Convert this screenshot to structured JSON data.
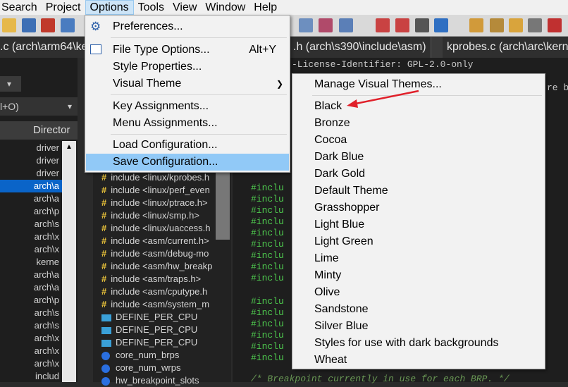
{
  "menubar": {
    "items": [
      "Search",
      "Project",
      "Options",
      "Tools",
      "View",
      "Window",
      "Help"
    ],
    "active": "Options"
  },
  "tabs": [
    {
      "label": ".c (arch\\arm64\\ke"
    },
    {
      "label": ".h (arch\\s390\\include\\asm)"
    },
    {
      "label": "kprobes.c (arch\\arc\\kerne"
    }
  ],
  "left_panel": {
    "filter_text": "l+O)",
    "column_header": "Director",
    "rows": [
      "driver",
      "driver",
      "driver",
      "arch\\a",
      "arch\\a",
      "arch\\p",
      "arch\\s",
      "arch\\x",
      "arch\\x",
      "kerne",
      "arch\\a",
      "arch\\a",
      "arch\\p",
      "arch\\s",
      "arch\\s",
      "arch\\x",
      "arch\\x",
      "arch\\x",
      "includ"
    ],
    "selected_index": 3
  },
  "symbols": [
    {
      "kind": "include",
      "text": "include <linux/kprobes.h"
    },
    {
      "kind": "include",
      "text": "include <linux/perf_even"
    },
    {
      "kind": "include",
      "text": "include <linux/ptrace.h>"
    },
    {
      "kind": "include",
      "text": "include <linux/smp.h>"
    },
    {
      "kind": "include",
      "text": "include <linux/uaccess.h"
    },
    {
      "kind": "include",
      "text": "include <asm/current.h>"
    },
    {
      "kind": "include",
      "text": "include <asm/debug-mo"
    },
    {
      "kind": "include",
      "text": "include <asm/hw_breakp"
    },
    {
      "kind": "include",
      "text": "include <asm/traps.h>"
    },
    {
      "kind": "include",
      "text": "include <asm/cputype.h"
    },
    {
      "kind": "include",
      "text": "include <asm/system_m"
    },
    {
      "kind": "define",
      "text": "DEFINE_PER_CPU"
    },
    {
      "kind": "define",
      "text": "DEFINE_PER_CPU"
    },
    {
      "kind": "define",
      "text": "DEFINE_PER_CPU"
    },
    {
      "kind": "func",
      "text": "core_num_brps"
    },
    {
      "kind": "func",
      "text": "core_num_wrps"
    },
    {
      "kind": "func",
      "text": "hw_breakpoint_slots"
    }
  ],
  "editor": {
    "license_line": "-License-Identifier: GPL-2.0-only",
    "right_fragment": "re br",
    "include_fragment": "#inclu",
    "comment_line": "/* Breakpoint currently in use for each BRP. */"
  },
  "options_menu": {
    "items": [
      {
        "label": "Preferences...",
        "shortcut": "",
        "submenu": false,
        "icon": "gear-icon"
      },
      {
        "label": "File Type Options...",
        "shortcut": "Alt+Y",
        "submenu": false,
        "icon": "list-icon"
      },
      {
        "label": "Style Properties...",
        "shortcut": "",
        "submenu": false
      },
      {
        "label": "Visual Theme",
        "shortcut": "",
        "submenu": true
      },
      {
        "label": "Key Assignments...",
        "shortcut": "",
        "submenu": false
      },
      {
        "label": "Menu Assignments...",
        "shortcut": "",
        "submenu": false
      },
      {
        "label": "Load Configuration...",
        "shortcut": "",
        "submenu": false
      },
      {
        "label": "Save Configuration...",
        "shortcut": "",
        "submenu": false,
        "highlighted": true
      }
    ]
  },
  "theme_submenu": {
    "manage": "Manage Visual Themes...",
    "themes": [
      "Black",
      "Bronze",
      "Cocoa",
      "Dark Blue",
      "Dark Gold",
      "Default Theme",
      "Grasshopper",
      "Light Blue",
      "Light Green",
      "Lime",
      "Minty",
      "Olive",
      "Sandstone",
      "Silver Blue",
      "Styles for use with dark backgrounds",
      "Wheat"
    ],
    "pointed_theme": "Black"
  },
  "colors": {
    "menu_highlight": "#91c9f7",
    "selection": "#0a64c8",
    "annotation_arrow": "#e0202a",
    "code_green": "#4ec94e"
  }
}
